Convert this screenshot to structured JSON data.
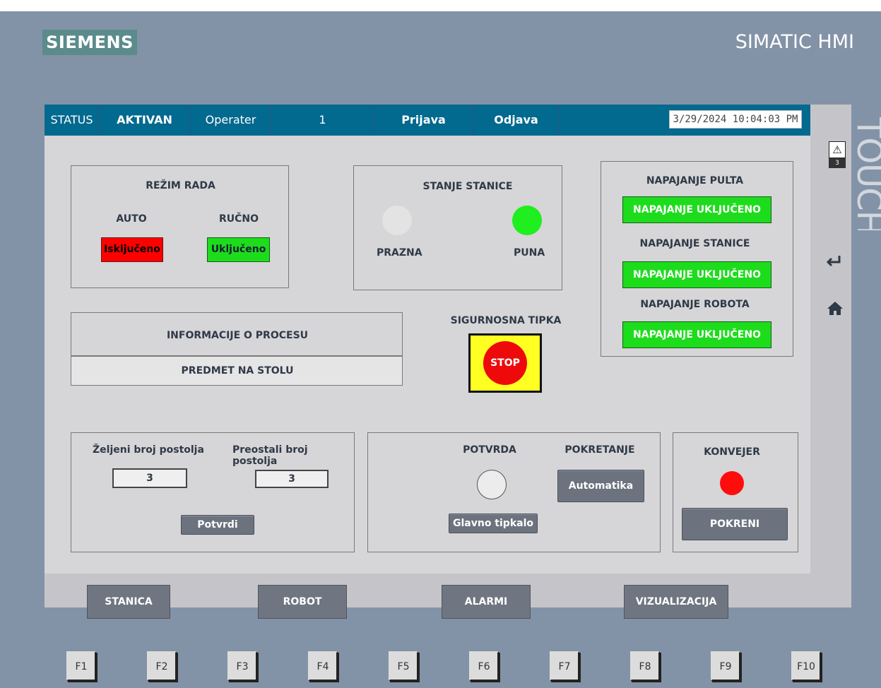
{
  "brand": {
    "logo": "SIEMENS",
    "product": "SIMATIC HMI",
    "side_text": "TOUCH"
  },
  "status_bar": {
    "status_label": "STATUS",
    "status_value": "AKTIVAN",
    "operator_label": "Operater",
    "operator_value": "1",
    "login": "Prijava",
    "logout": "Odjava",
    "datetime": "3/29/2024 10:04:03 PM"
  },
  "rezim_rada": {
    "title": "REŽIM RADA",
    "auto_label": "AUTO",
    "manual_label": "RUČNO",
    "auto_state": "Isključeno",
    "manual_state": "Uključeno"
  },
  "stanje_stanice": {
    "title": "STANJE STANICE",
    "empty_label": "PRAZNA",
    "full_label": "PUNA",
    "full_active": true
  },
  "napajanje": {
    "pult_title": "NAPAJANJE PULTA",
    "pult_state": "NAPAJANJE UKLJUČENO",
    "stanica_title": "NAPAJANJE STANICE",
    "stanica_state": "NAPAJANJE UKLJUČENO",
    "robot_title": "NAPAJANJE ROBOTA",
    "robot_state": "NAPAJANJE UKLJUČENO"
  },
  "info": {
    "title": "INFORMACIJE O PROCESU",
    "message": "PREDMET NA STOLU"
  },
  "safety": {
    "title": "SIGURNOSNA TIPKA",
    "stop": "STOP"
  },
  "postolja": {
    "desired_label": "Željeni broj postolja",
    "desired_value": "3",
    "remaining_label": "Preostali broj postolja",
    "remaining_value": "3",
    "confirm_button": "Potvrdi"
  },
  "pokretanje": {
    "confirm_title": "POTVRDA",
    "start_title": "POKRETANJE",
    "auto_button": "Automatika",
    "main_button": "Glavno tipkalo"
  },
  "konvejer": {
    "title": "KONVEJER",
    "start_button": "POKRENI"
  },
  "nav": {
    "stanica": "STANICA",
    "robot": "ROBOT",
    "alarmi": "ALARMI",
    "vizualizacija": "VIZUALIZACIJA"
  },
  "alarm_count": "3",
  "fkeys": [
    "F1",
    "F2",
    "F3",
    "F4",
    "F5",
    "F6",
    "F7",
    "F8",
    "F9",
    "F10"
  ],
  "colors": {
    "header": "#02698f",
    "green": "#1ddc1c",
    "red": "#ff0000",
    "frame": "#8393a7"
  },
  "icons": {
    "alarm": "warning-triangle-icon",
    "enter": "enter-arrow-icon",
    "home": "home-icon"
  }
}
